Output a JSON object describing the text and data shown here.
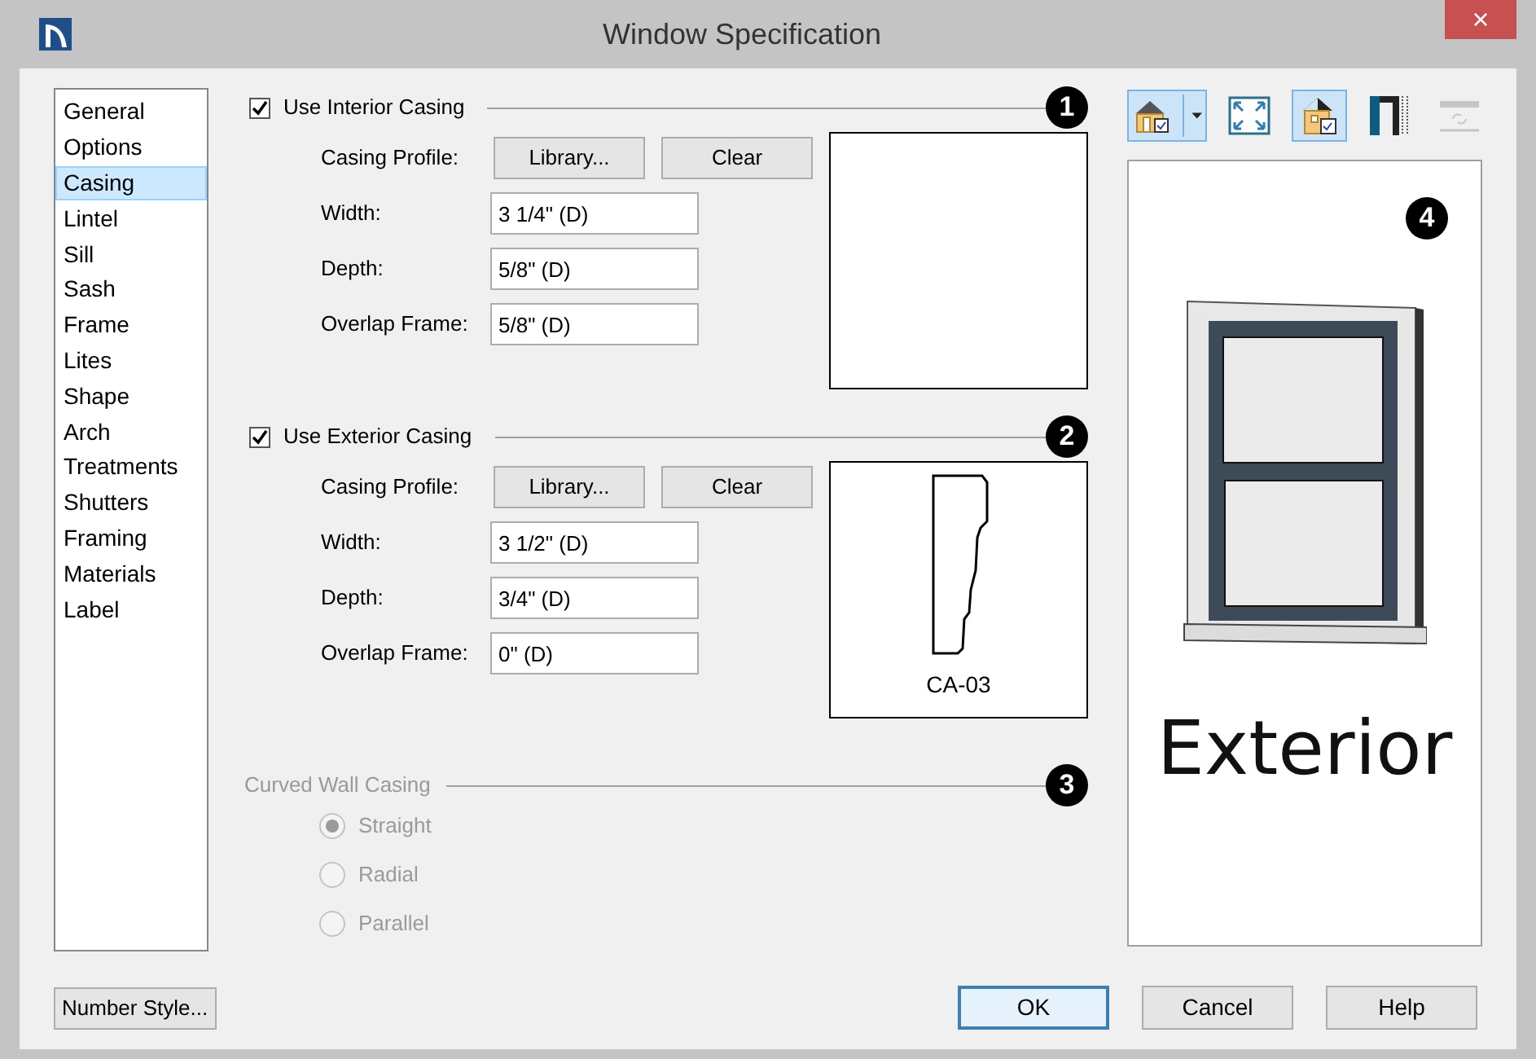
{
  "window": {
    "title": "Window Specification",
    "close": "×"
  },
  "sidebar": {
    "items": [
      {
        "label": "General",
        "selected": false
      },
      {
        "label": "Options",
        "selected": false
      },
      {
        "label": "Casing",
        "selected": true
      },
      {
        "label": "Lintel",
        "selected": false
      },
      {
        "label": "Sill",
        "selected": false
      },
      {
        "label": "Sash",
        "selected": false
      },
      {
        "label": "Frame",
        "selected": false
      },
      {
        "label": "Lites",
        "selected": false
      },
      {
        "label": "Shape",
        "selected": false
      },
      {
        "label": "Arch",
        "selected": false
      },
      {
        "label": "Treatments",
        "selected": false
      },
      {
        "label": "Shutters",
        "selected": false
      },
      {
        "label": "Framing",
        "selected": false
      },
      {
        "label": "Materials",
        "selected": false
      },
      {
        "label": "Label",
        "selected": false
      }
    ]
  },
  "sections": [
    {
      "kind": "casing",
      "label": "Use Interior Casing",
      "checked": true,
      "callout": "1",
      "profile_label": "Casing Profile:",
      "buttons": [
        "Library...",
        "Clear"
      ],
      "fields": [
        {
          "label": "Width:",
          "value": "3 1/4\" (D)"
        },
        {
          "label": "Depth:",
          "value": "5/8\" (D)"
        },
        {
          "label": "Overlap Frame:",
          "value": "5/8\" (D)"
        }
      ],
      "preview": {
        "has_profile": false
      }
    },
    {
      "kind": "casing",
      "label": "Use Exterior Casing",
      "checked": true,
      "callout": "2",
      "profile_label": "Casing Profile:",
      "buttons": [
        "Library...",
        "Clear"
      ],
      "fields": [
        {
          "label": "Width:",
          "value": "3 1/2\" (D)"
        },
        {
          "label": "Depth:",
          "value": "3/4\" (D)"
        },
        {
          "label": "Overlap Frame:",
          "value": "0\" (D)"
        }
      ],
      "preview": {
        "has_profile": true,
        "caption": "CA-03"
      }
    },
    {
      "kind": "radio",
      "label": "Curved Wall Casing",
      "disabled": true,
      "callout": "3",
      "options": [
        {
          "label": "Straight",
          "selected": true
        },
        {
          "label": "Radial",
          "selected": false
        },
        {
          "label": "Parallel",
          "selected": false
        }
      ]
    }
  ],
  "view": {
    "toolbar": [
      {
        "kind": "camera",
        "pressed": true,
        "disabled": false
      },
      {
        "kind": "fit",
        "pressed": false,
        "disabled": false
      },
      {
        "kind": "view",
        "pressed": true,
        "disabled": false
      },
      {
        "kind": "casing",
        "pressed": false,
        "disabled": false
      },
      {
        "kind": "swap",
        "pressed": false,
        "disabled": true
      }
    ],
    "callout": "4",
    "caption": "Exterior"
  },
  "footer": {
    "left_button": "Number Style...",
    "buttons": [
      {
        "label": "OK",
        "default": true
      },
      {
        "label": "Cancel",
        "default": false
      },
      {
        "label": "Help",
        "default": false
      }
    ]
  }
}
